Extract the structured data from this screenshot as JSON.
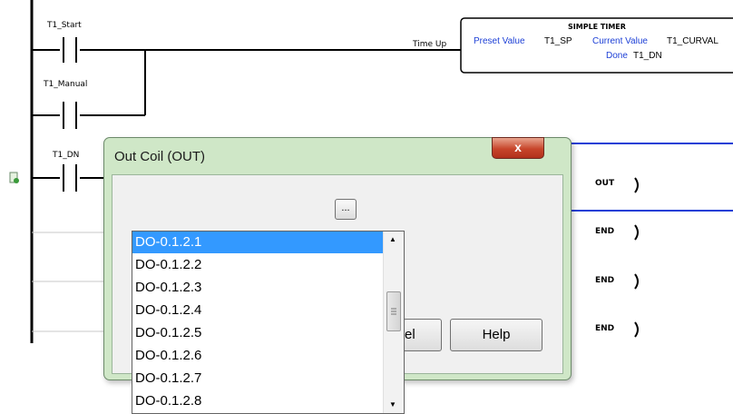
{
  "ladder": {
    "contacts": [
      "T1_Start",
      "T1_Manual",
      "T1_DN"
    ],
    "timer": {
      "input_label": "Time Up",
      "title": "SIMPLE TIMER",
      "preset_label": "Preset Value",
      "preset_value": "T1_SP",
      "current_label": "Current Value",
      "current_value": "T1_CURVAL",
      "done_label": "Done",
      "done_value": "T1_DN"
    },
    "coils": [
      "OUT",
      "END",
      "END",
      "END"
    ]
  },
  "dialog": {
    "title": "Out Coil (OUT)",
    "close_label": "x",
    "ellipsis_label": "...",
    "cancel_label_visible": "el",
    "help_label": "Help",
    "combo_value": ""
  },
  "dropdown": {
    "items": [
      "DO-0.1.2.1",
      "DO-0.1.2.2",
      "DO-0.1.2.3",
      "DO-0.1.2.4",
      "DO-0.1.2.5",
      "DO-0.1.2.6",
      "DO-0.1.2.7",
      "DO-0.1.2.8"
    ],
    "selected_index": 0
  },
  "colors": {
    "rail": "#000000",
    "selection": "#3399ff",
    "rung_highlight": "#1c3fd6",
    "dialog_frame": "#cfe7c7"
  }
}
